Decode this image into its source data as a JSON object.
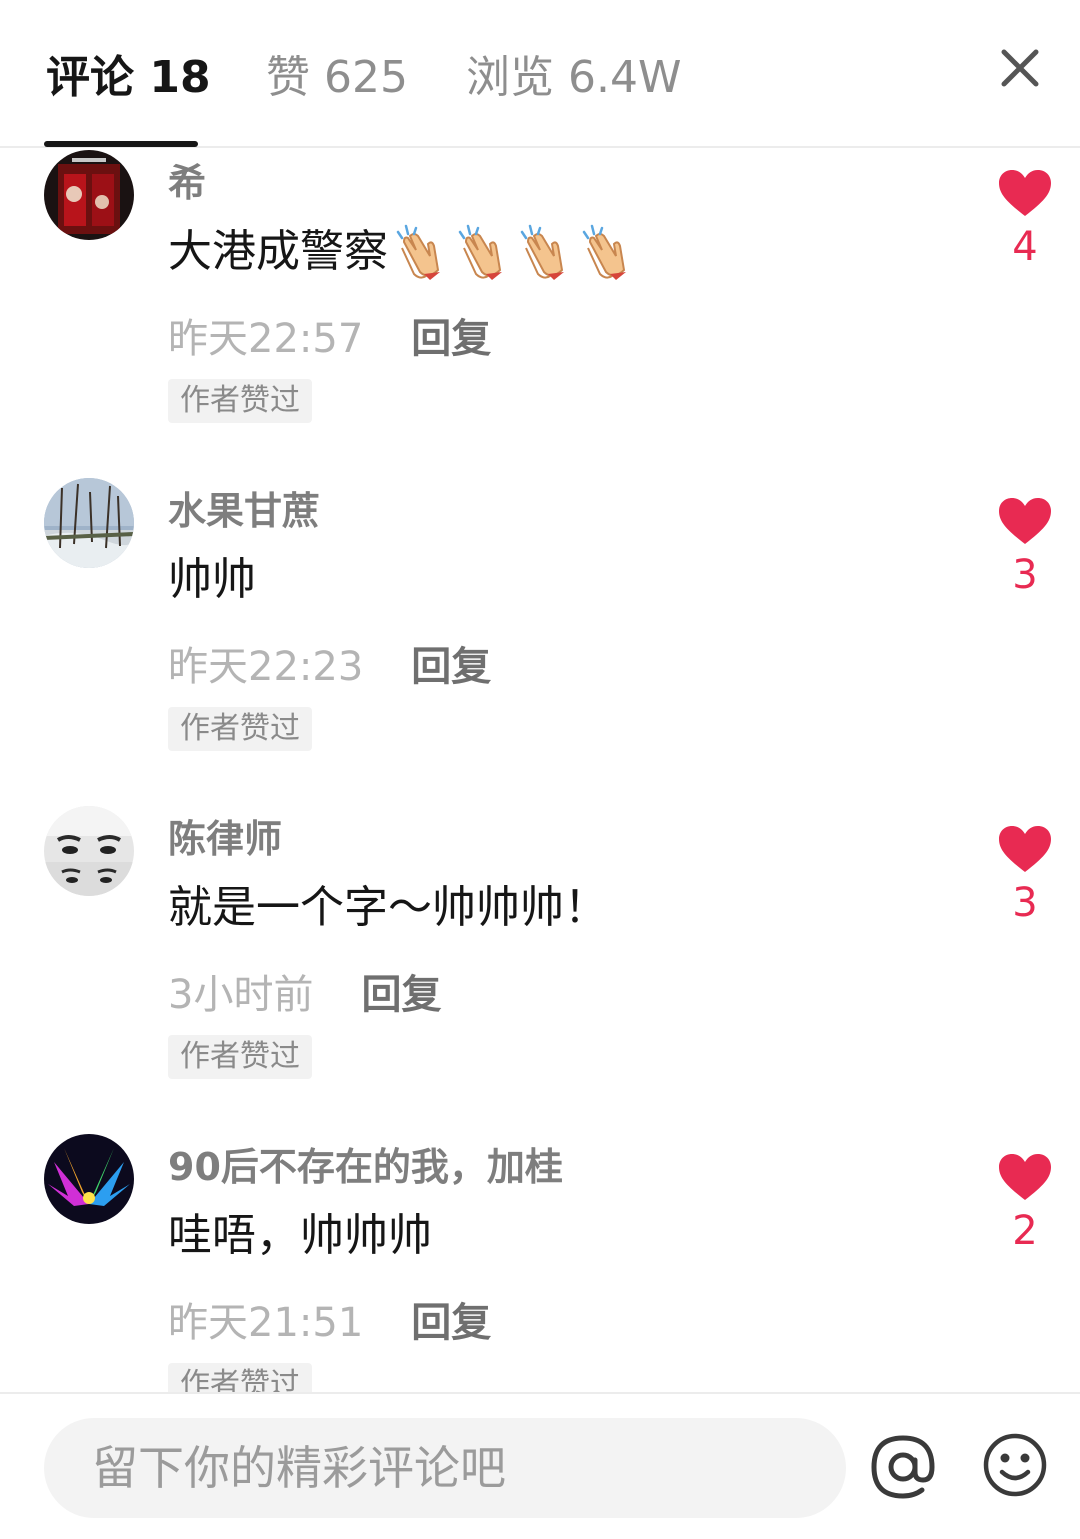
{
  "header": {
    "tabs": [
      {
        "label": "评论",
        "count": "18"
      },
      {
        "label": "赞",
        "count": "625"
      },
      {
        "label": "浏览",
        "count": "6.4W"
      }
    ]
  },
  "comments": [
    {
      "username": "希",
      "text": "大港成警察",
      "emoji": [
        "clapping-hands",
        "clapping-hands",
        "clapping-hands",
        "clapping-hands"
      ],
      "time": "昨天22:57",
      "reply_label": "回复",
      "author_tag": "作者赞过",
      "likes": "4"
    },
    {
      "username": "水果甘蔗",
      "text": "帅帅",
      "time": "昨天22:23",
      "reply_label": "回复",
      "author_tag": "作者赞过",
      "likes": "3"
    },
    {
      "username": "陈律师",
      "text": "就是一个字～帅帅帅！",
      "time": "3小时前",
      "reply_label": "回复",
      "author_tag": "作者赞过",
      "likes": "3"
    },
    {
      "username": "90后不存在的我，加桂",
      "text": "哇唔，帅帅帅",
      "time": "昨天21:51",
      "reply_label": "回复",
      "author_tag": "作者赞过",
      "likes": "2"
    }
  ],
  "input": {
    "placeholder": "留下你的精彩评论吧"
  },
  "icons": {
    "close": "close-icon",
    "like": "heart-icon",
    "mention": "at-icon",
    "emoji": "smiley-icon"
  },
  "colors": {
    "like_red": "#e82a52",
    "text_dark": "#161616",
    "text_gray": "#8e8e8e"
  }
}
